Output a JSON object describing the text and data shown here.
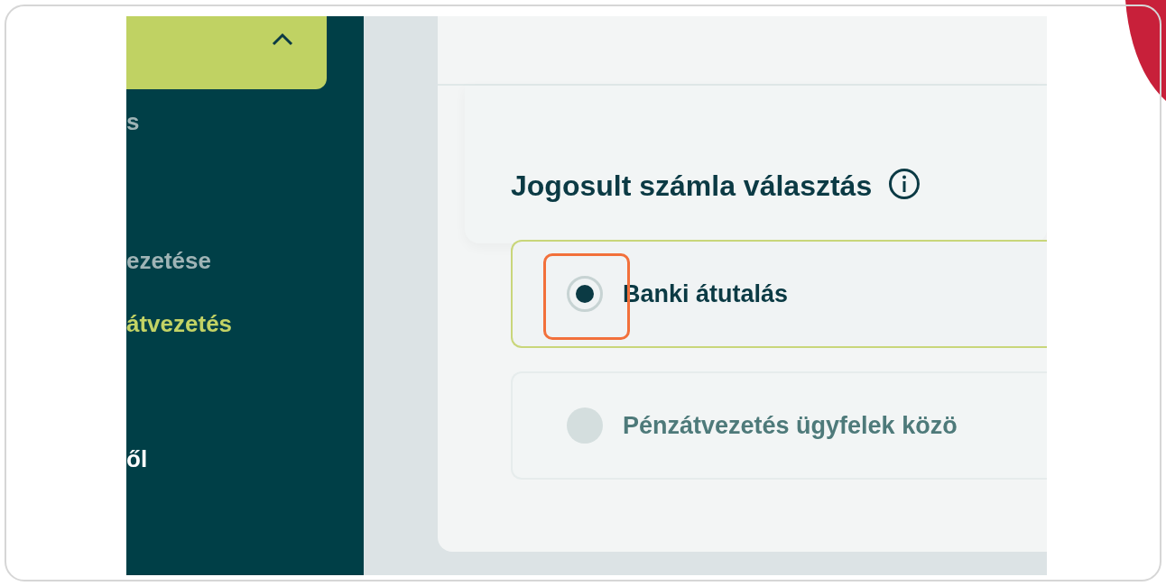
{
  "sidebar": {
    "header": {
      "expanded": true
    },
    "items": [
      {
        "label": "s",
        "kind": "subitem",
        "selected": false
      },
      {
        "label": "ezetése",
        "kind": "subitem",
        "selected": false
      },
      {
        "label": "átvezetés",
        "kind": "subitem",
        "selected": true
      },
      {
        "label": "ől",
        "kind": "heading",
        "selected": false
      }
    ]
  },
  "card": {
    "section": {
      "title": "Jogosult számla választás",
      "options": [
        {
          "label": "Banki átutalás",
          "selected": true
        },
        {
          "label": "Pénzátvezetés ügyfelek közö",
          "selected": false
        }
      ]
    }
  }
}
